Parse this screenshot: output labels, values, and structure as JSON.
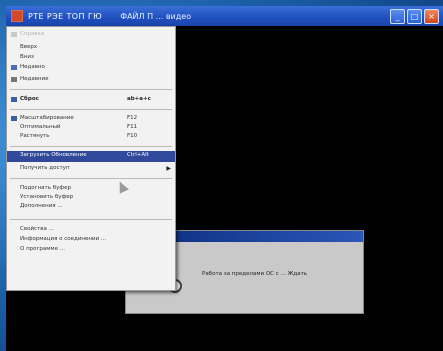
{
  "window": {
    "title": "РТЕ РЭЕ ТОП ГЮ",
    "subtitle": "ФАЙЛ П ... видео",
    "buttons": [
      "_",
      "□",
      "×"
    ]
  },
  "menu": {
    "items": [
      {
        "label": "Справка",
        "shortcut": "",
        "state": "dim"
      },
      {
        "label": "Вверх",
        "shortcut": ""
      },
      {
        "label": "Вниз",
        "shortcut": ""
      },
      {
        "label": "Недавно",
        "shortcut": ""
      },
      {
        "label": "Недавние",
        "shortcut": ""
      },
      {
        "label": "Сброс",
        "shortcut": "ab+a+с",
        "state": "bold"
      },
      {
        "label": "Масштабирование",
        "shortcut": "F12"
      },
      {
        "label": "Оптимальный",
        "shortcut": "F11"
      },
      {
        "label": "Растянуть",
        "shortcut": "F10"
      },
      {
        "label": "Загрузить Обновление",
        "shortcut": "Ctrl+Alt",
        "state": "highlight"
      },
      {
        "label": "Получить доступ",
        "shortcut": "",
        "submenu": true
      },
      {
        "label": "Подогнать буфер",
        "shortcut": ""
      },
      {
        "label": "Установить буфер",
        "shortcut": ""
      },
      {
        "label": "Дополнения ...",
        "shortcut": ""
      },
      {
        "label": "Свойства ...",
        "shortcut": ""
      },
      {
        "label": "Информация о соединении ...",
        "shortcut": ""
      },
      {
        "label": "О программе ...",
        "shortcut": ""
      }
    ]
  },
  "dialog": {
    "message": "Работа за пределами ОС с ... Ждать"
  },
  "colors": {
    "titlebar": "#1f4fbf",
    "highlight": "#30499a",
    "desktop": "#1f6dba"
  }
}
